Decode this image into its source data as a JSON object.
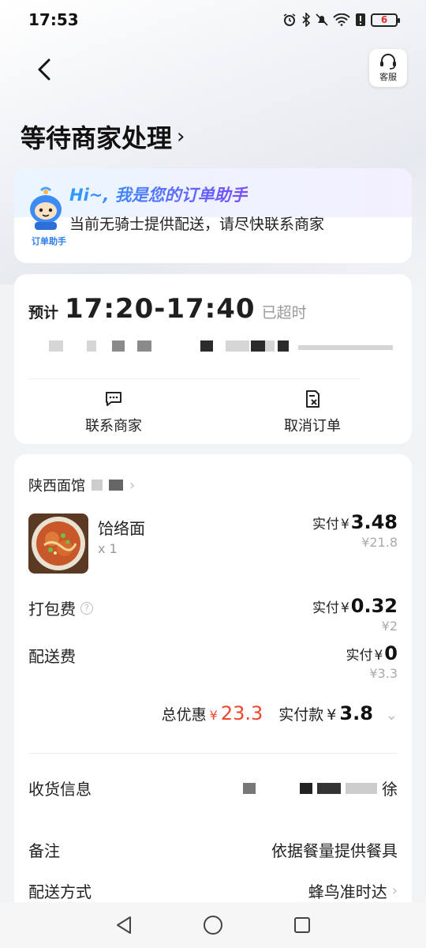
{
  "status_bar": {
    "time": "17:53",
    "battery": "6"
  },
  "header": {
    "customer_service_label": "客服",
    "title": "等待商家处理"
  },
  "assistant": {
    "avatar_caption": "订单助手",
    "greeting": "Hi~, 我是您的订单助手",
    "message": "当前无骑士提供配送，请尽快联系商家"
  },
  "eta": {
    "prefix": "预计",
    "time_range": "17:20-17:40",
    "status": "已超时",
    "actions": [
      {
        "label": "联系商家",
        "icon": "chat-icon"
      },
      {
        "label": "取消订单",
        "icon": "cancel-order-icon"
      }
    ]
  },
  "order": {
    "shop_name": "陕西面馆",
    "item": {
      "name": "饸络面",
      "quantity": "x 1",
      "paid_label": "实付",
      "paid_currency": "¥",
      "paid_value": "3.48",
      "original_price": "¥21.8"
    },
    "packaging": {
      "label": "打包费",
      "paid_label": "实付",
      "paid_currency": "¥",
      "paid_value": "0.32",
      "original_price": "¥2"
    },
    "delivery": {
      "label": "配送费",
      "paid_label": "实付",
      "paid_currency": "¥",
      "paid_value": "0",
      "original_price": "¥3.3"
    },
    "summary": {
      "discount_label": "总优惠",
      "discount_currency": "¥",
      "discount_value": "23.3",
      "total_label": "实付款",
      "total_currency": "¥",
      "total_value": "3.8"
    },
    "info": [
      {
        "label": "收货信息",
        "value": "徐"
      },
      {
        "label": "备注",
        "value": "依据餐量提供餐具"
      },
      {
        "label": "配送方式",
        "value": "蜂鸟准时达"
      }
    ]
  },
  "colors": {
    "accent_red": "#f0462e",
    "assistant_blue": "#2e9bff",
    "assistant_purple": "#7a4dff"
  }
}
